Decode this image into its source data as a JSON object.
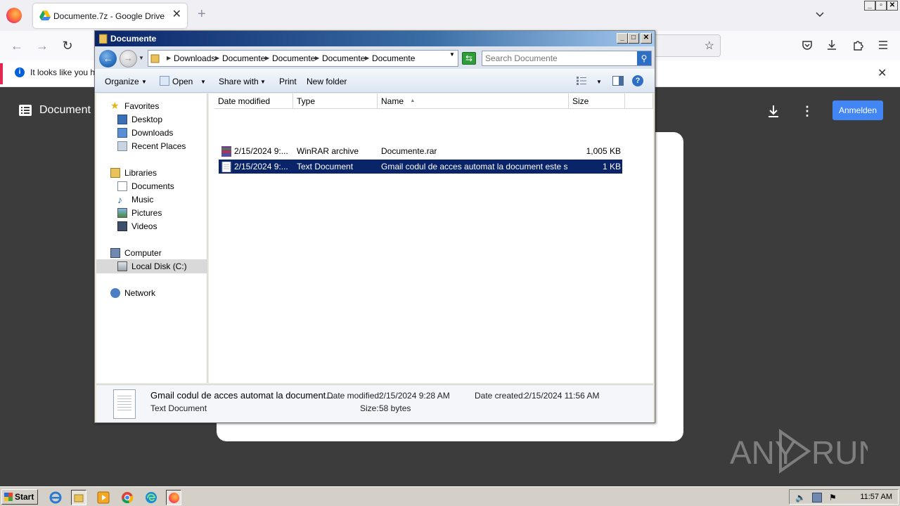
{
  "browser": {
    "tab_title": "Documente.7z - Google Drive",
    "tab_close": "✕",
    "new_tab": "+",
    "notification": "It looks like you ha",
    "notification_close": "✕"
  },
  "drive": {
    "title": "Document",
    "signin_label": "Anmelden",
    "more": "⋮"
  },
  "explorer": {
    "title": "Documente",
    "breadcrumb": [
      "Downloads",
      "Documente",
      "Documente",
      "Documente",
      "Documente"
    ],
    "search_placeholder": "Search Documente",
    "toolbar": {
      "organize": "Organize",
      "open": "Open",
      "share_with": "Share with",
      "print": "Print",
      "new_folder": "New folder",
      "help": "?"
    },
    "nav": {
      "favorites": "Favorites",
      "desktop": "Desktop",
      "downloads": "Downloads",
      "recent_places": "Recent Places",
      "libraries": "Libraries",
      "documents": "Documents",
      "music": "Music",
      "pictures": "Pictures",
      "videos": "Videos",
      "computer": "Computer",
      "local_disk": "Local Disk (C:)",
      "network": "Network"
    },
    "columns": {
      "date_modified": "Date modified",
      "type": "Type",
      "name": "Name",
      "sort_indicator": "▲",
      "size": "Size"
    },
    "files": [
      {
        "date": "2/15/2024 9:...",
        "type": "WinRAR archive",
        "name": "Documente.rar",
        "size": "1,005 KB",
        "icon": "winrar-archive-icon",
        "selected": false
      },
      {
        "date": "2/15/2024 9:...",
        "type": "Text Document",
        "name": "Gmail codul de acces automat la document este set...",
        "size": "1 KB",
        "icon": "text-document-icon",
        "selected": true
      }
    ],
    "details": {
      "name": "Gmail codul de acces automat la document...",
      "type": "Text Document",
      "date_modified_label": "Date modified:",
      "date_modified": "2/15/2024 9:28 AM",
      "date_created_label": "Date created:",
      "date_created": "2/15/2024 11:56 AM",
      "size_label": "Size:",
      "size": "58 bytes"
    }
  },
  "taskbar": {
    "start_label": "Start",
    "clock": "11:57 AM"
  },
  "watermark": "ANY RUN",
  "colors": {
    "drive_background": "#3c3c3c",
    "signin_blue": "#4285f4",
    "selection": "#0a246a",
    "titlebar": "#0a246a"
  }
}
